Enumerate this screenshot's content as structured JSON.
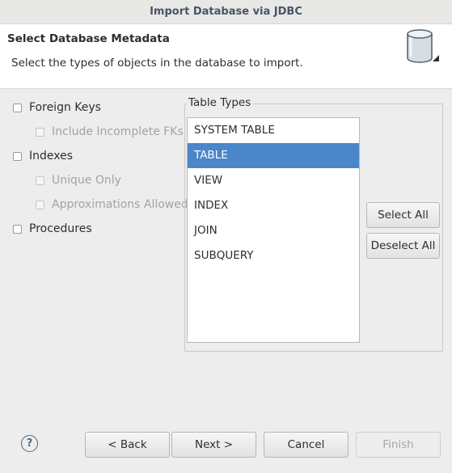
{
  "window": {
    "title": "Import Database via JDBC"
  },
  "header": {
    "title": "Select Database Metadata",
    "description": "Select the types of objects in the database to import.",
    "icon": "database-icon"
  },
  "options": {
    "foreign_keys": {
      "label": "Foreign Keys",
      "checked": false
    },
    "include_incomplete_fks": {
      "label": "Include Incomplete FKs",
      "checked": false,
      "enabled": false
    },
    "indexes": {
      "label": "Indexes",
      "checked": false
    },
    "unique_only": {
      "label": "Unique Only",
      "checked": false,
      "enabled": false
    },
    "approximations_allowed": {
      "label": "Approximations Allowed",
      "checked": false,
      "enabled": false
    },
    "procedures": {
      "label": "Procedures",
      "checked": false
    }
  },
  "table_types": {
    "title": "Table Types",
    "items": [
      "SYSTEM TABLE",
      "TABLE",
      "VIEW",
      "INDEX",
      "JOIN",
      "SUBQUERY"
    ],
    "selected": "TABLE",
    "select_all_label": "Select All",
    "deselect_all_label": "Deselect All"
  },
  "footer": {
    "help_label": "?",
    "back_label": "< Back",
    "next_label": "Next >",
    "cancel_label": "Cancel",
    "finish_label": "Finish"
  },
  "colors": {
    "selection": "#4a86c8",
    "header_background": "#ffffff",
    "dialog_background": "#ededed"
  }
}
